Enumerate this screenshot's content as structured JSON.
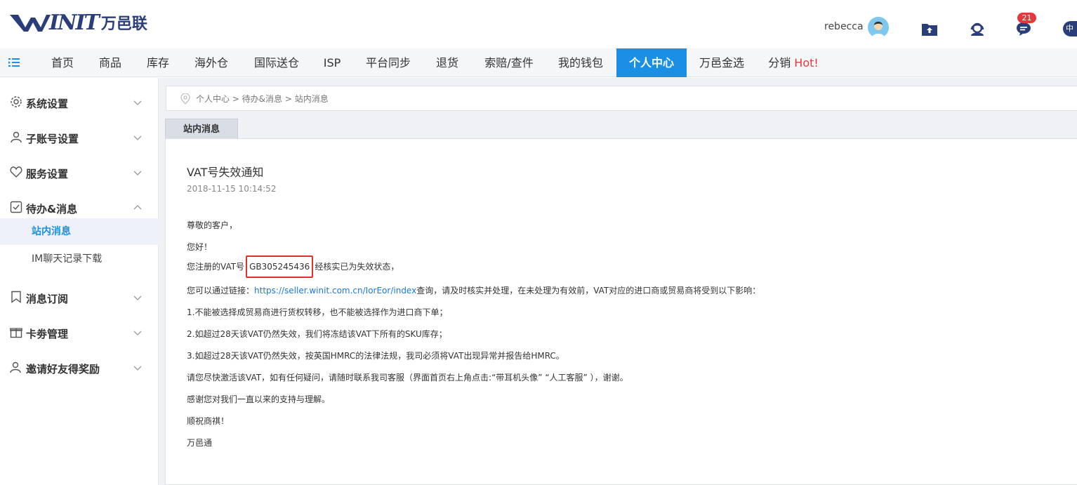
{
  "header": {
    "logo_en": "INIT",
    "logo_cn": "万邑联",
    "username": "rebecca",
    "message_count": "21",
    "lang": "中"
  },
  "nav": {
    "items": [
      {
        "label": "首页"
      },
      {
        "label": "商品"
      },
      {
        "label": "库存"
      },
      {
        "label": "海外仓"
      },
      {
        "label": "国际送仓"
      },
      {
        "label": "ISP"
      },
      {
        "label": "平台同步"
      },
      {
        "label": "退货"
      },
      {
        "label": "索赔/查件"
      },
      {
        "label": "我的钱包"
      },
      {
        "label": "个人中心"
      },
      {
        "label": "万邑金选"
      },
      {
        "label": "分销"
      }
    ],
    "hot_label": "Hot!"
  },
  "sidebar": {
    "groups": [
      {
        "label": "系统设置"
      },
      {
        "label": "子账号设置"
      },
      {
        "label": "服务设置"
      },
      {
        "label": "待办&消息"
      },
      {
        "label": "消息订阅"
      },
      {
        "label": "卡劵管理"
      },
      {
        "label": "邀请好友得奖励"
      }
    ],
    "subitems": [
      {
        "label": "站内消息"
      },
      {
        "label": "IM聊天记录下载"
      }
    ]
  },
  "breadcrumb": "个人中心 > 待办&消息 > 站内消息",
  "tab_label": "站内消息",
  "message": {
    "title": "VAT号失效通知",
    "time": "2018-11-15 10:14:52",
    "greeting": "尊敬的客户，",
    "hello": "您好！",
    "vat_prefix": "您注册的VAT号",
    "vat_number": "GB305245436",
    "vat_suffix": "经核实已为失效状态，",
    "link_prefix": "您可以通过链接：",
    "link_url": "https://seller.winit.com.cn/IorEor/index",
    "link_suffix": "查询，请及时核实并处理，在未处理为有效前，VAT对应的进口商或贸易商将受到以下影响：",
    "impact1": "1.不能被选择成贸易商进行货权转移，也不能被选择作为进口商下单；",
    "impact2": "2.如超过28天该VAT仍然失效，我们将冻结该VAT下所有的SKU库存；",
    "impact3": "3.如超过28天该VAT仍然失效，按英国HMRC的法律法规，我司必须将VAT出现异常并报告给HMRC。",
    "contact": "请您尽快激活该VAT，如有任何疑问，请随时联系我司客服（界面首页右上角点击:“带耳机头像” “人工客服” ），谢谢。",
    "thanks": "感谢您对我们一直以来的支持与理解。",
    "wish": "顺祝商祺！",
    "sign": "万邑通"
  }
}
